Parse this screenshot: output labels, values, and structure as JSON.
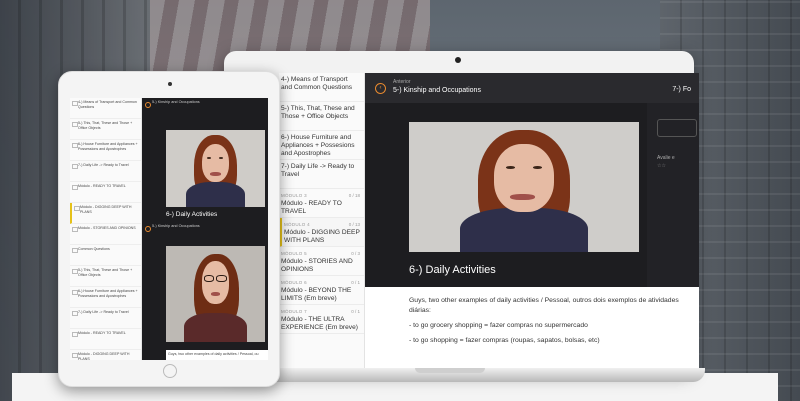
{
  "laptop": {
    "sidebar_items": [
      {
        "module": "",
        "label": "4-) Means of Transport and Common Questions",
        "count": ""
      },
      {
        "module": "",
        "label": "5-) This, That, These and Those + Office Objects",
        "count": ""
      },
      {
        "module": "",
        "label": "6-) House Furniture and Appliances + Possesions and Apostrophes",
        "count": ""
      },
      {
        "module": "",
        "label": "7-) Daily Life -> Ready to Travel",
        "count": ""
      },
      {
        "module": "MÓDULO 3",
        "label": "Módulo - READY TO TRAVEL",
        "count": "0 / 18"
      },
      {
        "module": "MÓDULO 4",
        "label": "Módulo - DIGGING DEEP WITH PLANS",
        "count": "0 / 13"
      },
      {
        "module": "MÓDULO 5",
        "label": "Módulo - STORIES AND OPINIONS",
        "count": "0 / 3"
      },
      {
        "module": "MÓDULO 6",
        "label": "Módulo - BEYOND THE LIMITS (Em breve)",
        "count": "0 / 1"
      },
      {
        "module": "MÓDULO 7",
        "label": "Módulo - THE ULTRA EXPERIENCE (Em breve)",
        "count": "0 / 1"
      }
    ],
    "header": {
      "small": "Anterior",
      "title": "5-) Kinship and Occupations",
      "count": "7-) Fo"
    },
    "video_title": "6-) Daily Activities",
    "panel_label": "Avalie e",
    "text": [
      "Guys, two other examples of daily activities / Pessoal, outros dois exemplos de atividades diárias:",
      "- to go grocery shopping = fazer compras no supermercado",
      "- to go shopping = fazer compras (roupas, sapatos, bolsas, etc)"
    ]
  },
  "tablet": {
    "sidebar_items": [
      "4-) Means of Transport and Common Questions",
      "5-) This, That, These and Those + Office Objects",
      "6-) House Furniture and Appliances + Possessions and Apostrophes",
      "7-) Daily Life -> Ready to Travel",
      "Módulo - READY TO TRAVEL",
      "Módulo - DIGGING DEEP WITH PLANS",
      "Módulo - STORIES AND OPINIONS",
      "Common Questions",
      "5-) This, That, These and Those + Office Objects",
      "6-) House Furniture and Appliances + Possessions and Apostrophes",
      "7-) Daily Life -> Ready to Travel",
      "Módulo - READY TO TRAVEL",
      "Módulo - DIGGING DEEP WITH PLANS",
      "Módulo - STORIES AND OPINIONS",
      "Módulo - BEYOND THE LIMITS (Em breve)"
    ],
    "header": "5-) Kinship and Occupations",
    "video_title": "6-) Daily Activities",
    "header2": "5-) Kinship and Occupations",
    "footer_text": "Guys, two other examples of daily activities / Pessoal, ou"
  }
}
